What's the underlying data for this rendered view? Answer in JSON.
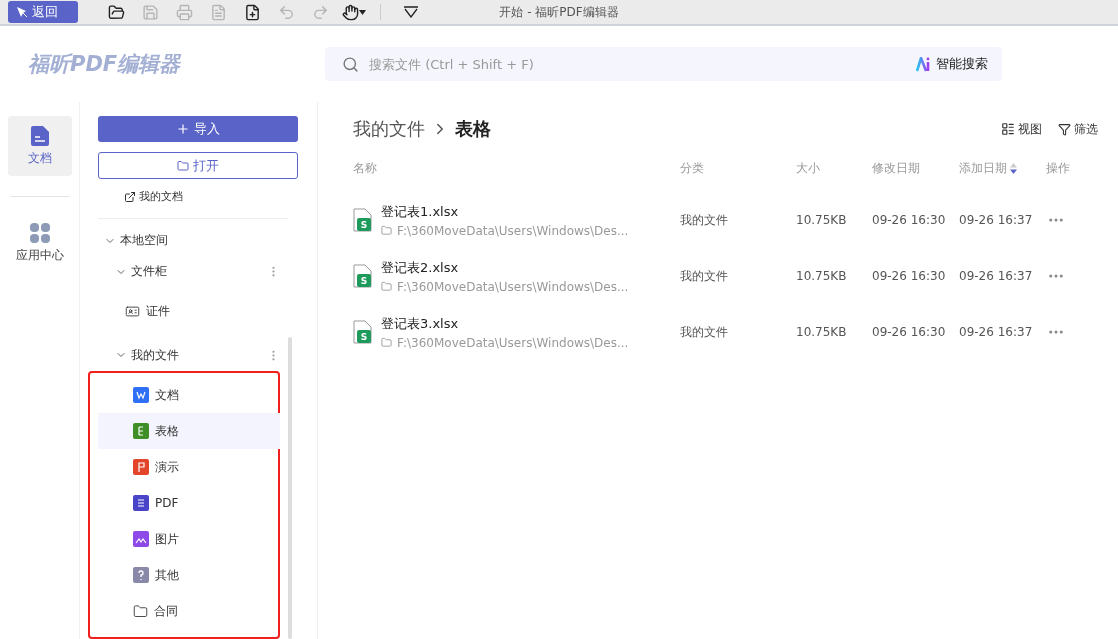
{
  "toolbar": {
    "back_button": "返回",
    "title": "开始 - 福昕PDF编辑器",
    "tools": [
      {
        "kind": "open",
        "disabled": false
      },
      {
        "kind": "save",
        "disabled": true
      },
      {
        "kind": "print",
        "disabled": true
      },
      {
        "kind": "export",
        "disabled": true
      },
      {
        "kind": "new",
        "disabled": false
      },
      {
        "kind": "undo",
        "disabled": true
      },
      {
        "kind": "redo",
        "disabled": true
      },
      {
        "kind": "hand",
        "disabled": false
      },
      {
        "kind": "more",
        "disabled": false
      }
    ]
  },
  "header": {
    "logo": "福昕PDF编辑器",
    "search": {
      "placeholder": "搜索文件 (Ctrl + Shift + F)",
      "ai_button": "智能搜索"
    }
  },
  "rail": [
    {
      "label": "文档",
      "kind": "docs",
      "selected": true
    },
    {
      "label": "应用中心",
      "kind": "apps",
      "selected": false
    }
  ],
  "nav": {
    "import_button": "导入",
    "open_button": "打开",
    "my_docs_link": "我的文档",
    "tree": [
      {
        "label": "本地空间",
        "expanded": true,
        "children": [
          {
            "label": "文件柜",
            "expanded": true,
            "has_menu": true,
            "highlighted": false,
            "children": [
              {
                "label": "证件",
                "kind": "id",
                "selected": false
              }
            ]
          },
          {
            "label": "我的文件",
            "expanded": true,
            "has_menu": true,
            "highlighted": true,
            "children": [
              {
                "label": "文档",
                "kind": "doc",
                "selected": false
              },
              {
                "label": "表格",
                "kind": "sheet",
                "selected": true
              },
              {
                "label": "演示",
                "kind": "slides",
                "selected": false
              },
              {
                "label": "PDF",
                "kind": "pdf",
                "selected": false
              },
              {
                "label": "图片",
                "kind": "image",
                "selected": false
              },
              {
                "label": "其他",
                "kind": "other",
                "selected": false
              },
              {
                "label": "合同",
                "kind": "folder",
                "selected": false
              }
            ]
          }
        ]
      }
    ]
  },
  "main": {
    "breadcrumb": [
      "我的文件",
      "表格"
    ],
    "view_button": "视图",
    "filter_button": "筛选",
    "columns": [
      {
        "label": "名称",
        "sorted": false
      },
      {
        "label": "分类",
        "sorted": false
      },
      {
        "label": "大小",
        "sorted": false
      },
      {
        "label": "修改日期",
        "sorted": false
      },
      {
        "label": "添加日期",
        "sorted": true
      },
      {
        "label": "操作",
        "sorted": false
      }
    ],
    "rows": [
      {
        "badge": "S",
        "name": "登记表1.xlsx",
        "path": "F:\\360MoveData\\Users\\Windows\\Des...",
        "category": "我的文件",
        "size": "10.75KB",
        "modified": "09-26 16:30",
        "added": "09-26 16:37"
      },
      {
        "badge": "S",
        "name": "登记表2.xlsx",
        "path": "F:\\360MoveData\\Users\\Windows\\Des...",
        "category": "我的文件",
        "size": "10.75KB",
        "modified": "09-26 16:30",
        "added": "09-26 16:37"
      },
      {
        "badge": "S",
        "name": "登记表3.xlsx",
        "path": "F:\\360MoveData\\Users\\Windows\\Des...",
        "category": "我的文件",
        "size": "10.75KB",
        "modified": "09-26 16:30",
        "added": "09-26 16:37"
      }
    ]
  }
}
